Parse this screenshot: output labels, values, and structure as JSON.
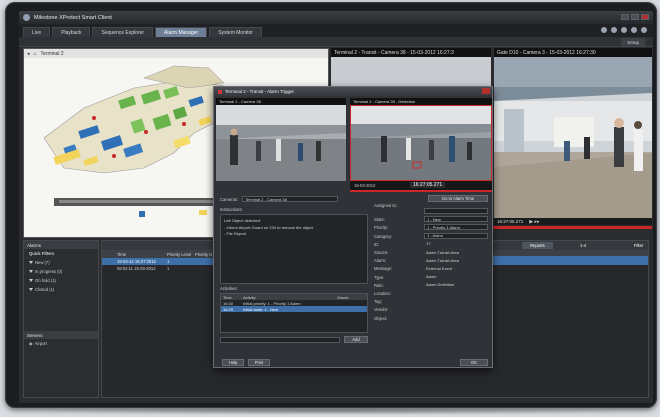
{
  "window": {
    "title": "Milestone XProtect Smart Client"
  },
  "tabs": [
    {
      "label": "Live",
      "active": false
    },
    {
      "label": "Playback",
      "active": false
    },
    {
      "label": "Sequence Explorer",
      "active": false
    },
    {
      "label": "Alarm Manager",
      "active": true
    },
    {
      "label": "System Monitor",
      "active": false
    }
  ],
  "toolbar": {
    "setup_label": "Setup"
  },
  "map": {
    "breadcrumb": "Terminal 2"
  },
  "cameras": {
    "cam1_title": "Terminal 2 - Transit - Camera 38 - 15-03-2012 16:27:3",
    "cam2_title": "Gate D10 - Camera 3 - 15-03-2012 16:27:30",
    "time_display": "16:27:05.271"
  },
  "dialog": {
    "title": "Terminal 2 - Transit - Alarm Trigger",
    "cam_a_title": "Terminal 2 - Camera 38",
    "cam_b_title": "Terminal 2 - Camera 39 - Detection",
    "time_a": "15-03-2012",
    "time_b": "16:27:05.271",
    "camera_label": "Cameras:",
    "camera_value": "Terminal 2 - Camera 38",
    "goto_label": "Go to Alarm Time",
    "instructions_label": "Instructions:",
    "instructions": [
      "Left Object detected:",
      "- Inform Airport Guard on 234 to remove the object",
      "- File Report"
    ],
    "activities_label": "Activities:",
    "activities_header": [
      "Time",
      "Activity",
      "Owner"
    ],
    "activities": [
      {
        "time": "16:30",
        "activity": "Initial priority: 1 - Priority 1 Alarm",
        "owner": ""
      },
      {
        "time": "16:29",
        "activity": "Initial state: 1 - New",
        "owner": ""
      }
    ],
    "add_label": "Add",
    "help_label": "Help",
    "print_label": "Print",
    "ok_label": "OK",
    "details": [
      {
        "k": "Assigned to:",
        "v": ""
      },
      {
        "k": "State:",
        "v": "1 - New"
      },
      {
        "k": "Priority:",
        "v": "1 - Priority 1 Alarm"
      },
      {
        "k": "Category:",
        "v": "1 - Alarm"
      },
      {
        "k": "ID:",
        "v": "17"
      },
      {
        "k": "Source:",
        "v": "Alarm Transit Area"
      },
      {
        "k": "Alarm:",
        "v": "Alarm Transit Area"
      },
      {
        "k": "Message:",
        "v": "External Event"
      },
      {
        "k": "Type:",
        "v": "Alarm"
      },
      {
        "k": "Rule:",
        "v": "Alarm Definition"
      },
      {
        "k": "Location:",
        "v": ""
      },
      {
        "k": "Tag:",
        "v": ""
      },
      {
        "k": "Vendor:",
        "v": ""
      },
      {
        "k": "Object:",
        "v": ""
      }
    ]
  },
  "left_panel": {
    "alarms_title": "Alarms",
    "quick_filters_label": "Quick Filters",
    "filters": [
      "New (7)",
      "In progress (0)",
      "On hold (1)",
      "Closed (1)"
    ],
    "servers_title": "Servers",
    "server": "Airport"
  },
  "alarm_list": {
    "report_label": "Reports",
    "pager": "1-4",
    "filter_label": "Filter",
    "columns": [
      "",
      "Time",
      "Priority Level",
      "Priority N"
    ],
    "rows": [
      {
        "icon": "",
        "time": "15-03-12 16:27:2012",
        "level": "1",
        "name": "",
        "selected": true
      },
      {
        "icon": "",
        "time": "08:02:11 15-03-2012",
        "level": "1",
        "name": "",
        "selected": false
      }
    ]
  },
  "colors": {
    "accent": "#3d6fa8",
    "active_tab": "#6d7f96",
    "alarm_red": "#c82828"
  }
}
